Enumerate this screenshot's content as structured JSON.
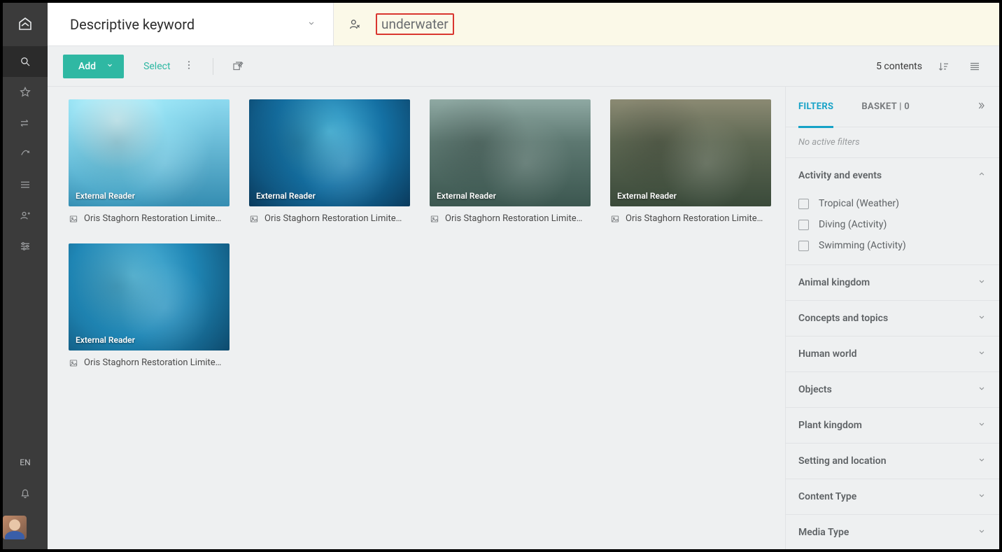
{
  "header": {
    "title": "Descriptive keyword",
    "search_term": "underwater"
  },
  "toolbar": {
    "add_label": "Add",
    "select_label": "Select",
    "count_label": "5 contents"
  },
  "sidebar": {
    "lang": "EN"
  },
  "right": {
    "tab_filters": "FILTERS",
    "tab_basket": "BASKET | 0",
    "no_active": "No active filters"
  },
  "results": [
    {
      "badge": "External Reader",
      "name": "Oris Staghorn Restoration Limite…",
      "tclass": "t1"
    },
    {
      "badge": "External Reader",
      "name": "Oris Staghorn Restoration Limite…",
      "tclass": "t2"
    },
    {
      "badge": "External Reader",
      "name": "Oris Staghorn Restoration Limite…",
      "tclass": "t3"
    },
    {
      "badge": "External Reader",
      "name": "Oris Staghorn Restoration Limite…",
      "tclass": "t4"
    },
    {
      "badge": "External Reader",
      "name": "Oris Staghorn Restoration Limite…",
      "tclass": "t5"
    }
  ],
  "facets": [
    {
      "title": "Activity and events",
      "open": true,
      "options": [
        "Tropical (Weather)",
        "Diving (Activity)",
        "Swimming (Activity)"
      ]
    },
    {
      "title": "Animal kingdom",
      "open": false
    },
    {
      "title": "Concepts and topics",
      "open": false
    },
    {
      "title": "Human world",
      "open": false
    },
    {
      "title": "Objects",
      "open": false
    },
    {
      "title": "Plant kingdom",
      "open": false
    },
    {
      "title": "Setting and location",
      "open": false
    },
    {
      "title": "Content Type",
      "open": false
    },
    {
      "title": "Media Type",
      "open": false
    }
  ]
}
